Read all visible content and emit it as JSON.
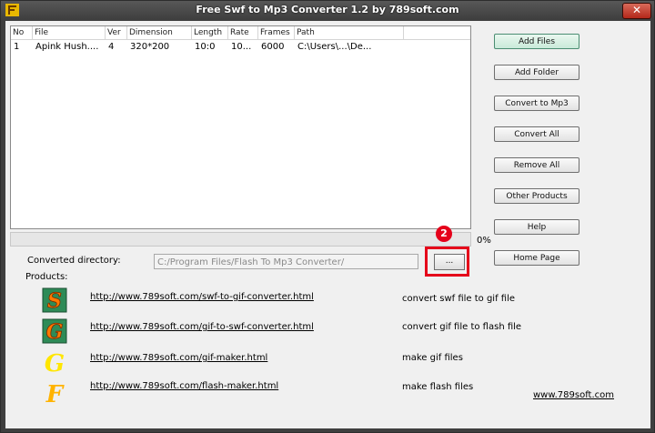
{
  "window": {
    "title": "Free Swf to Mp3 Converter 1.2 by 789soft.com",
    "close_label": "✕"
  },
  "list": {
    "columns": [
      "No",
      "File",
      "Ver",
      "Dimension",
      "Length",
      "Rate",
      "Frames",
      "Path"
    ],
    "rows": [
      {
        "no": "1",
        "file": "Apink Hush....",
        "ver": "4",
        "dimension": "320*200",
        "length": "10:0",
        "rate": "10...",
        "frames": "6000",
        "path": "C:\\Users\\...\\De..."
      }
    ]
  },
  "progress": {
    "value": 0,
    "label": "0%"
  },
  "buttons": {
    "add_files": "Add Files",
    "add_folder": "Add Folder",
    "convert_to_mp3": "Convert to Mp3",
    "convert_all": "Convert All",
    "remove_all": "Remove All",
    "other_products": "Other Products",
    "help": "Help",
    "home_page": "Home Page"
  },
  "converted_directory": {
    "label": "Converted directory:",
    "value": "C:/Program Files/Flash To Mp3 Converter/",
    "browse_label": "..."
  },
  "annotation": {
    "marker": "2"
  },
  "products": {
    "label": "Products:",
    "items": [
      {
        "icon": "s-swf-icon",
        "url": "http://www.789soft.com/swf-to-gif-converter.html",
        "desc": "convert swf file to gif file"
      },
      {
        "icon": "g-gif-icon",
        "url": "http://www.789soft.com/gif-to-swf-converter.html",
        "desc": "convert gif file to flash file"
      },
      {
        "icon": "g-yellow-icon",
        "url": "http://www.789soft.com/gif-maker.html",
        "desc": "make gif files"
      },
      {
        "icon": "f-orange-icon",
        "url": "http://www.789soft.com/flash-maker.html",
        "desc": "make flash files"
      }
    ]
  },
  "site_link": "www.789soft.com",
  "colors": {
    "highlight": "#e5001a",
    "primary_button": "#c9ead9"
  }
}
